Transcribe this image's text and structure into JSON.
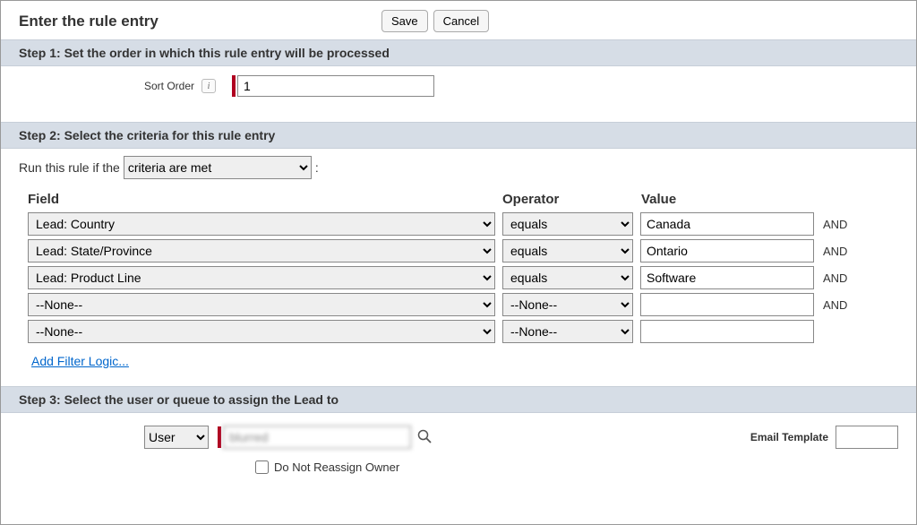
{
  "header": {
    "title": "Enter the rule entry",
    "save": "Save",
    "cancel": "Cancel"
  },
  "step1": {
    "header": "Step 1: Set the order in which this rule entry will be processed",
    "label": "Sort Order",
    "info_glyph": "i",
    "value": "1"
  },
  "step2": {
    "header": "Step 2: Select the criteria for this rule entry",
    "run_if_prefix": "Run this rule if the",
    "run_if_value": "criteria are met",
    "run_if_suffix": ":",
    "columns": {
      "field": "Field",
      "operator": "Operator",
      "value": "Value"
    },
    "and": "AND",
    "none_option": "--None--",
    "rows": [
      {
        "field": "Lead: Country",
        "operator": "equals",
        "value": "Canada",
        "show_and": true
      },
      {
        "field": "Lead: State/Province",
        "operator": "equals",
        "value": "Ontario",
        "show_and": true
      },
      {
        "field": "Lead: Product Line",
        "operator": "equals",
        "value": "Software",
        "show_and": true
      },
      {
        "field": "--None--",
        "operator": "--None--",
        "value": "",
        "show_and": true
      },
      {
        "field": "--None--",
        "operator": "--None--",
        "value": "",
        "show_and": false
      }
    ],
    "add_filter_logic": "Add Filter Logic..."
  },
  "step3": {
    "header": "Step 3: Select the user or queue to assign the Lead to",
    "assignee_type": "User",
    "assignee_name": "blurred",
    "email_template_label": "Email Template",
    "email_template_value": "",
    "checkbox_label": "Do Not Reassign Owner",
    "checkbox_checked": false
  }
}
